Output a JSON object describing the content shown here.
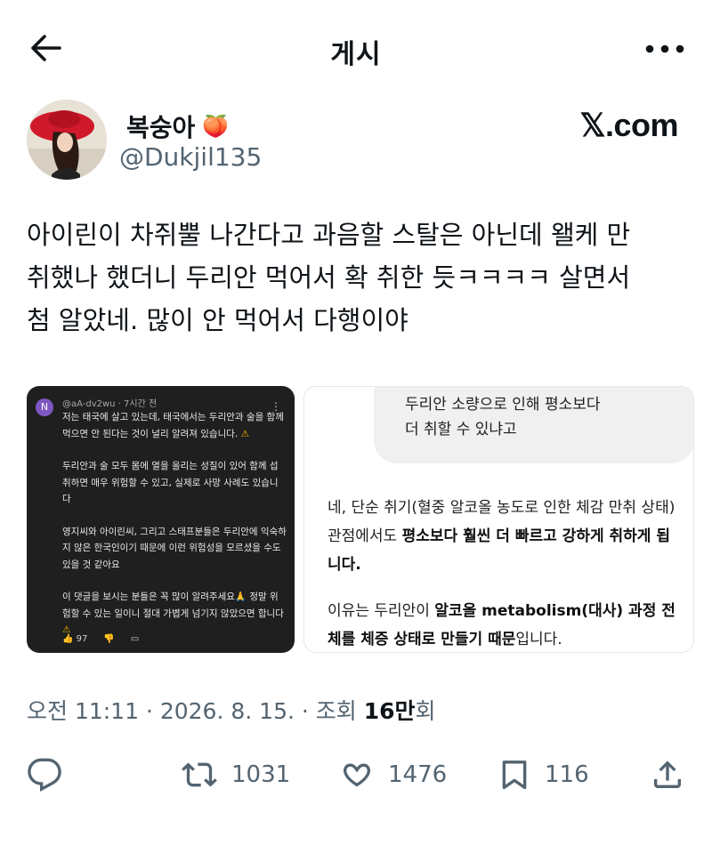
{
  "header": {
    "title": "게시",
    "back_icon": "arrow-left-icon",
    "more_icon": "more-horizontal-icon"
  },
  "author": {
    "display_name": "복숭아",
    "emoji": "🍑",
    "handle": "@Dukjil135",
    "site_logo": "𝕏.com"
  },
  "post": {
    "text_lines": [
      "아이린이 차쥐뿔 나간다고 과음할 스탈은 아닌데 왤케 만",
      "취했나 했더니 두리안 먹어서 확 취한 듯ㅋㅋㅋㅋ 살면서",
      "첨 알았네. 많이 안 먹어서 다행이야"
    ]
  },
  "media_left": {
    "avatar_letter": "N",
    "user": "@aA-dv2wu · 7시간 전",
    "paragraphs": [
      "저는 태국에 살고 있는데, 태국에서는 두리안과 술을 함께 먹으면 안 된다는 것이 널리 알려져 있습니다.",
      "두리안과 술 모두 몸에 열을 올리는 성질이 있어 함께 섭취하면 매우 위험할 수 있고, 실제로 사망 사례도 있습니다",
      "영지씨와 아이린씨, 그리고 스태프분들은 두리안에 익숙하지 않은 한국인이기 때문에 이런 위험성을 모르셨을 수도 있을 것 같아요",
      "이 댓글을 보시는 분들은 꼭 많이 알려주세요🙏 정말 위험할 수 있는 일이니 절대 가볍게 넘기지 않았으면 합니다"
    ],
    "like_count": "97"
  },
  "media_right": {
    "question_line1": "두리안 소량으로 인해 평소보다",
    "question_line2": "더 취할 수 있냐고",
    "answer1_pre": "네, 단순 취기(혈중 알코올 농도로 인한 체감 만취 상태) 관점에서도 ",
    "answer1_bold": "평소보다 훨씬 더 빠르고 강하게 취하게 됩니다.",
    "answer2_pre": "이유는 두리안이 ",
    "answer2_bold": "알코올 metabolism(대사) 과정 전체를 체증 상태로 만들기 때문",
    "answer2_post": "입니다."
  },
  "meta": {
    "time": "오전 11:11",
    "date": "2026. 8. 15.",
    "views_label": "조회",
    "views_number": "16만",
    "views_suffix": "회"
  },
  "actions": {
    "reply_icon": "reply-icon",
    "retweet_icon": "retweet-icon",
    "retweets": "1031",
    "like_icon": "heart-icon",
    "likes": "1476",
    "bookmark_icon": "bookmark-icon",
    "bookmarks": "116",
    "share_icon": "share-icon"
  }
}
